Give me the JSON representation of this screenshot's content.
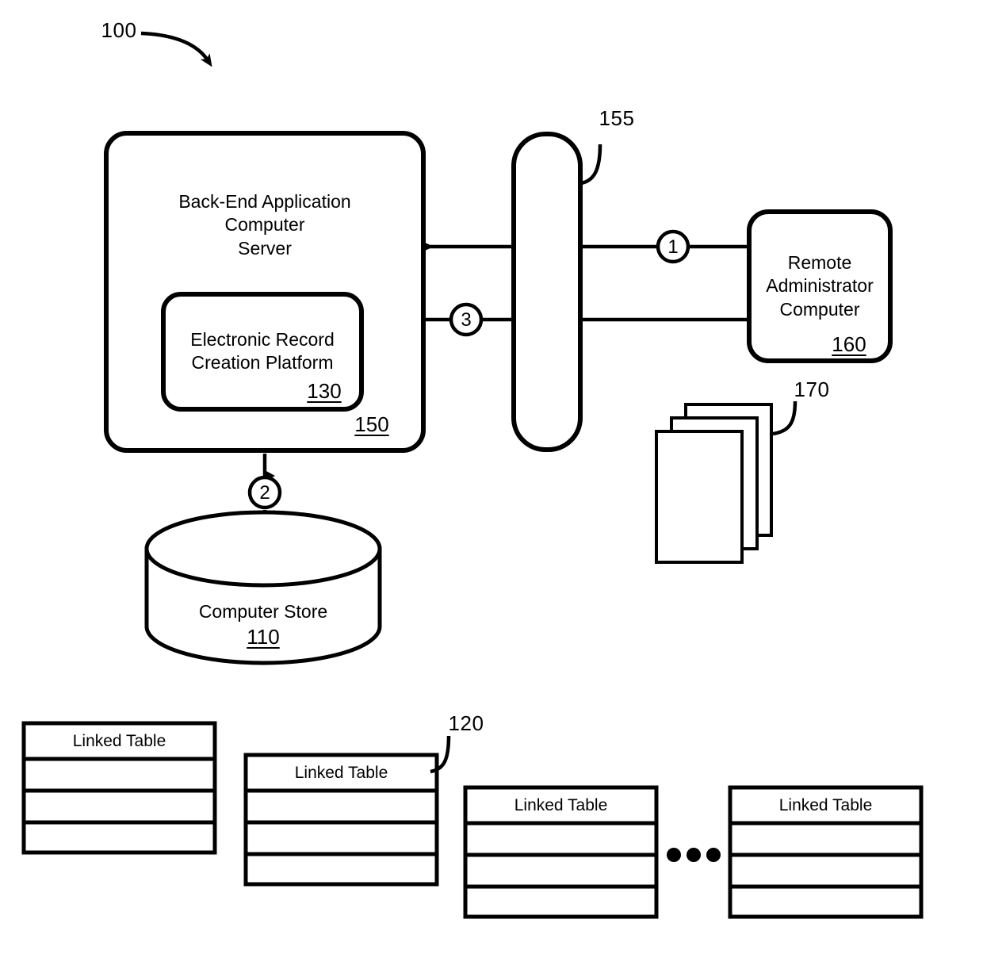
{
  "figure": {
    "reference_numeral": "100"
  },
  "server": {
    "title": "Back-End Application\nComputer\nServer",
    "ref": "150",
    "platform": {
      "title": "Electronic Record\nCreation Platform",
      "ref": "130"
    }
  },
  "network": {
    "ref": "155"
  },
  "admin": {
    "title": "Remote\nAdministrator\nComputer",
    "ref": "160"
  },
  "documents": {
    "ref": "170"
  },
  "store": {
    "title": "Computer Store",
    "ref": "110"
  },
  "flows": [
    {
      "id": "1",
      "label": "1"
    },
    {
      "id": "2",
      "label": "2"
    },
    {
      "id": "3",
      "label": "3"
    }
  ],
  "tables": {
    "ref": "120",
    "header_label": "Linked Table",
    "items": [
      {
        "header": "Linked Table"
      },
      {
        "header": "Linked Table"
      },
      {
        "header": "Linked Table"
      },
      {
        "header": "Linked Table"
      }
    ],
    "ellipsis": "• • •"
  },
  "colors": {
    "stroke": "#000000",
    "fill": "#ffffff"
  }
}
